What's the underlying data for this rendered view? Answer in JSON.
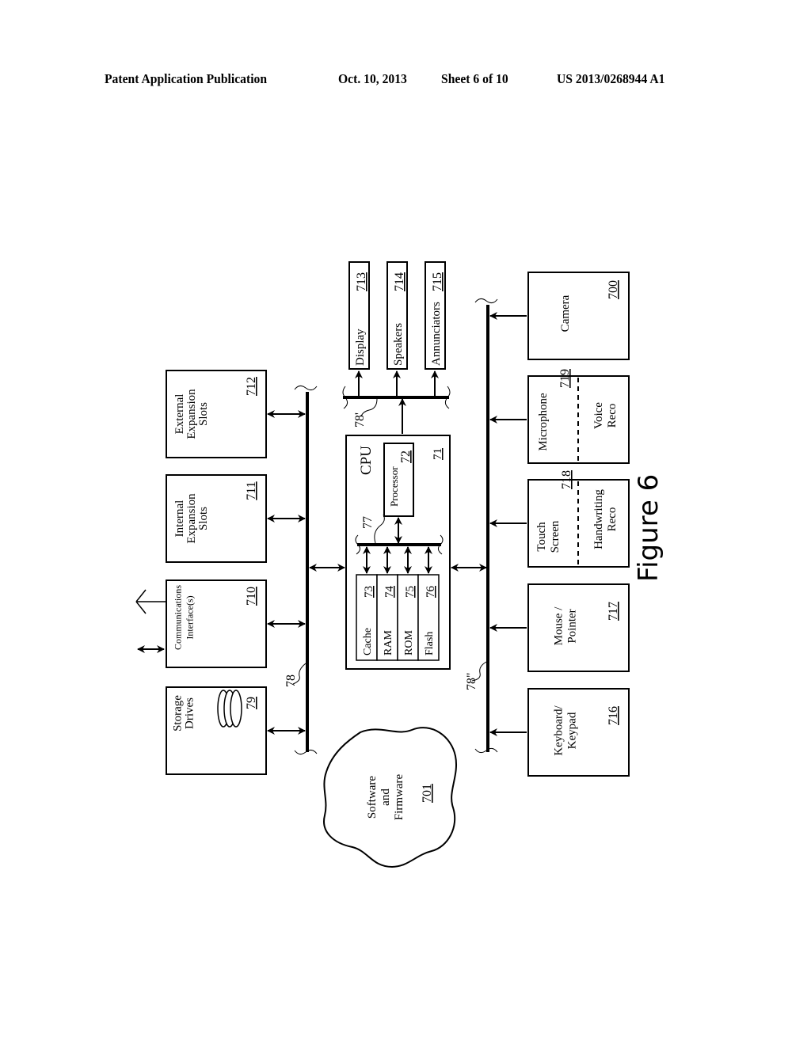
{
  "header": {
    "publication": "Patent Application Publication",
    "date": "Oct. 10, 2013",
    "sheet": "Sheet 6 of 10",
    "number": "US 2013/0268944 A1"
  },
  "figure_label": "Figure 6",
  "buses": {
    "left": "78",
    "top": "78'",
    "right": "78\"",
    "internal": "77"
  },
  "cpu": {
    "label": "CPU",
    "ref": "71",
    "processor": {
      "label": "Processor",
      "ref": "72"
    },
    "memories": [
      {
        "label": "Cache",
        "ref": "73"
      },
      {
        "label": "RAM",
        "ref": "74"
      },
      {
        "label": "ROM",
        "ref": "75"
      },
      {
        "label": "Flash",
        "ref": "76"
      }
    ]
  },
  "left_blocks": [
    {
      "lines": [
        "Storage",
        "Drives"
      ],
      "ref": "79"
    },
    {
      "lines": [
        "Communications",
        "Interface(s)"
      ],
      "ref": "710"
    },
    {
      "lines": [
        "Internal",
        "Expansion",
        "Slots"
      ],
      "ref": "711"
    },
    {
      "lines": [
        "External",
        "Expansion",
        "Slots"
      ],
      "ref": "712"
    }
  ],
  "output_blocks": [
    {
      "label": "Display",
      "ref": "713"
    },
    {
      "label": "Speakers",
      "ref": "714"
    },
    {
      "label": "Annunciators",
      "ref": "715"
    }
  ],
  "input_blocks": [
    {
      "lines": [
        "Keyboard/",
        "Keypad"
      ],
      "ref": "716"
    },
    {
      "lines": [
        "Mouse /",
        "Pointer"
      ],
      "ref": "717"
    },
    {
      "lines": [
        "Touch",
        "Screen"
      ],
      "ref": "718",
      "sub_lines": [
        "Handwriting",
        "Reco"
      ]
    },
    {
      "lines": [
        "Microphone"
      ],
      "ref": "719",
      "sub_lines": [
        "Voice",
        "Reco"
      ]
    },
    {
      "lines": [
        "Camera"
      ],
      "ref": "700"
    }
  ],
  "cloud": {
    "lines": [
      "Software",
      "and",
      "Firmware"
    ],
    "ref": "701"
  }
}
